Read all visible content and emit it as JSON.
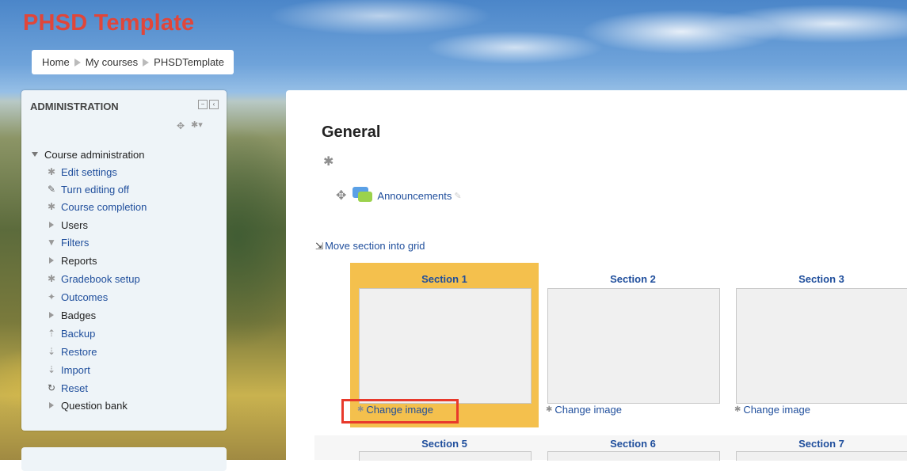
{
  "site": {
    "title": "PHSD Template"
  },
  "breadcrumb": [
    "Home",
    "My courses",
    "PHSDTemplate"
  ],
  "admin_block": {
    "title": "ADMINISTRATION",
    "section": "Course administration",
    "items": [
      {
        "label": "Edit settings",
        "icon": "gear-icon"
      },
      {
        "label": "Turn editing off",
        "icon": "pencil-icon"
      },
      {
        "label": "Course completion",
        "icon": "gear-icon"
      },
      {
        "label": "Users",
        "icon": "expand-arrow-icon"
      },
      {
        "label": "Filters",
        "icon": "filter-icon"
      },
      {
        "label": "Reports",
        "icon": "expand-arrow-icon"
      },
      {
        "label": "Gradebook setup",
        "icon": "gear-icon"
      },
      {
        "label": "Outcomes",
        "icon": "outcomes-icon"
      },
      {
        "label": "Badges",
        "icon": "expand-arrow-icon"
      },
      {
        "label": "Backup",
        "icon": "upload-icon"
      },
      {
        "label": "Restore",
        "icon": "download-icon"
      },
      {
        "label": "Import",
        "icon": "download-icon"
      },
      {
        "label": "Reset",
        "icon": "reset-icon"
      },
      {
        "label": "Question bank",
        "icon": "expand-arrow-icon"
      }
    ]
  },
  "main": {
    "title": "General",
    "announcements": "Announcements",
    "move_section": "Move section into grid",
    "change_image": "Change image",
    "sections_row1": [
      "Section 1",
      "Section 2",
      "Section 3"
    ],
    "sections_row2": [
      "Section 5",
      "Section 6",
      "Section 7"
    ]
  },
  "colors": {
    "title_red": "#e0463a",
    "link_blue": "#1f4e9c",
    "selected": "#f4c04d",
    "highlight": "#e8392b"
  }
}
